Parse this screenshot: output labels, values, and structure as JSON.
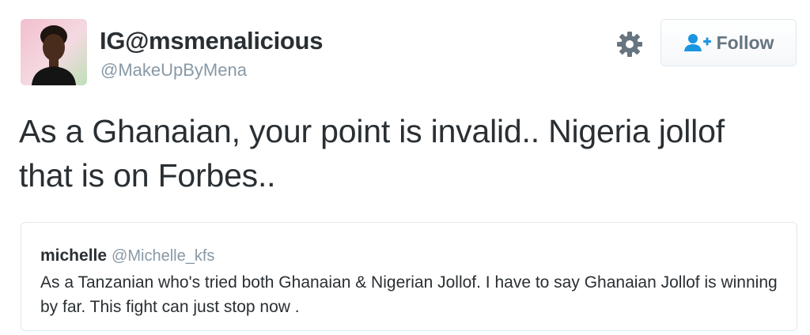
{
  "author": {
    "display_name": "IG@msmenalicious",
    "handle": "@MakeUpByMena",
    "avatar_icon": "profile-photo"
  },
  "actions": {
    "settings_icon": "gear-icon",
    "follow_icon": "add-user-icon",
    "follow_label": "Follow"
  },
  "tweet": {
    "text": "As a Ghanaian, your point is invalid.. Nigeria jollof that is on Forbes.."
  },
  "quoted_tweet": {
    "display_name": "michelle",
    "handle": "@Michelle_kfs",
    "text": "As a Tanzanian who's tried both Ghanaian & Nigerian Jollof. I have to say Ghanaian Jollof is winning by far. This fight can just stop now ."
  },
  "colors": {
    "text_primary": "#292f33",
    "text_secondary": "#8899a6",
    "border": "#e1e8ed",
    "accent": "#1b95e0"
  }
}
